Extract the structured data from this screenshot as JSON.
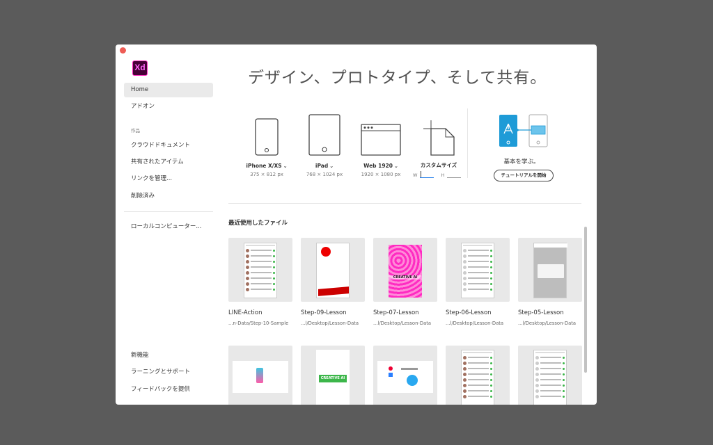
{
  "app": {
    "logo_text": "Xd"
  },
  "sidebar": {
    "home": "Home",
    "addons": "アドオン",
    "section_works": "作品",
    "items": [
      "クラウドドキュメント",
      "共有されたアイテム",
      "リンクを管理...",
      "削除済み"
    ],
    "local": "ローカルコンピューター...",
    "footer": [
      "新機能",
      "ラーニングとサポート",
      "フィードバックを提供"
    ]
  },
  "main": {
    "headline": "デザイン、プロトタイプ、そして共有。",
    "presets": [
      {
        "name": "iPhone X/XS",
        "size": "375 × 812 px",
        "icon": "iphone-icon"
      },
      {
        "name": "iPad",
        "size": "768 × 1024 px",
        "icon": "ipad-icon"
      },
      {
        "name": "Web 1920",
        "size": "1920 × 1080 px",
        "icon": "browser-window-icon"
      },
      {
        "name": "カスタムサイズ",
        "icon": "custom-size-icon",
        "w_label": "W",
        "h_label": "H"
      }
    ],
    "learn": {
      "title": "基本を学ぶ。",
      "button": "チュートリアルを開始"
    },
    "recent_title": "最近使用したファイル",
    "recent_files": [
      {
        "name": "LINE-Action",
        "path": "...n-Data/Step-10-Sample"
      },
      {
        "name": "Step-09-Lesson",
        "path": "...l/Desktop/Lesson-Data"
      },
      {
        "name": "Step-07-Lesson",
        "path": "...l/Desktop/Lesson-Data"
      },
      {
        "name": "Step-06-Lesson",
        "path": "...l/Desktop/Lesson-Data"
      },
      {
        "name": "Step-05-Lesson",
        "path": "...l/Desktop/Lesson-Data"
      }
    ],
    "thumb_text": {
      "creative_ai": "CREATIVE AI"
    }
  },
  "colors": {
    "accent_blue": "#2680eb",
    "xd_bg": "#470137",
    "xd_pink": "#ff61f6",
    "tutorial_blue": "#1e9bd7",
    "thumb_red": "#cc0000",
    "thumb_magenta": "#ff2bc2",
    "thumb_green": "#3cb64a"
  }
}
